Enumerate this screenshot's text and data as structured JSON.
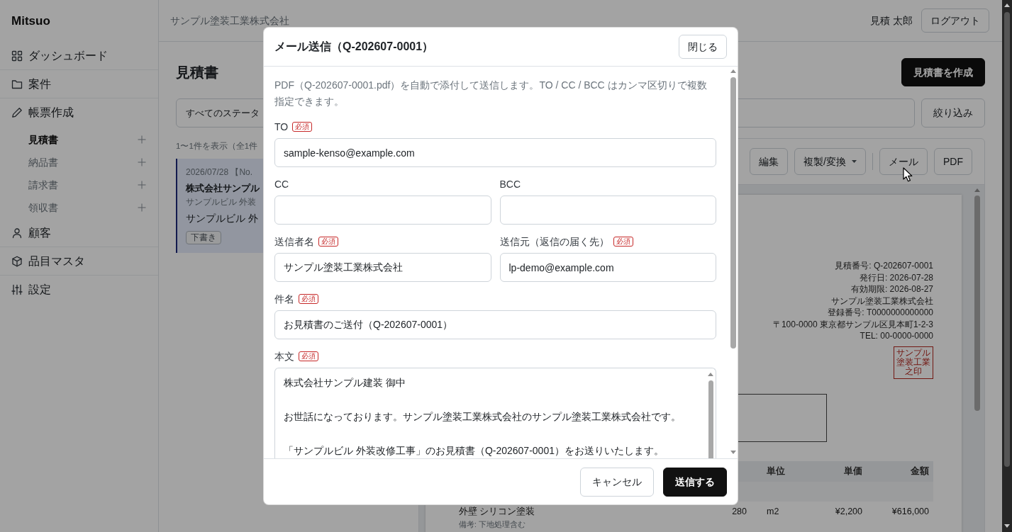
{
  "sidebar": {
    "brand": "Mitsuo",
    "items": [
      {
        "label": "ダッシュボード",
        "selected": false
      },
      {
        "label": "案件",
        "selected": false
      },
      {
        "label": "帳票作成",
        "selected": false,
        "children": [
          {
            "label": "見積書",
            "selected": true
          },
          {
            "label": "納品書",
            "selected": false
          },
          {
            "label": "請求書",
            "selected": false
          },
          {
            "label": "領収書",
            "selected": false
          }
        ]
      },
      {
        "label": "顧客",
        "selected": false
      },
      {
        "label": "品目マスタ",
        "selected": false
      },
      {
        "label": "設定",
        "selected": false
      }
    ]
  },
  "header": {
    "company": "サンプル塗装工業株式会社",
    "user": "見積 太郎",
    "logout_button": "ログアウト"
  },
  "page": {
    "title": "見積書",
    "create_button": "見積書を作成",
    "status_filter": "すべてのステータ",
    "filter_button": "絞り込み",
    "result_count": "1〜1件を表示（全1件"
  },
  "quote_list": [
    {
      "date_number": "2026/07/28 【No.",
      "customer": "株式会社サンプル",
      "subtitle": "サンプルビル 外装",
      "project": "サンプルビル 外",
      "status": "下書き",
      "selected": true
    }
  ],
  "detail": {
    "toolbar_groups": [
      {
        "buttons": [
          {
            "label": "編集",
            "kind": "button"
          },
          {
            "label": "複製/変換",
            "kind": "dropdown"
          }
        ]
      },
      {
        "buttons": [
          {
            "label": "メール",
            "kind": "button"
          },
          {
            "label": "PDF",
            "kind": "button"
          }
        ]
      }
    ],
    "document": {
      "issuer_lines": [
        "見積番号: Q-202607-0001",
        "発行日: 2026-07-28",
        "有効期限: 2026-08-27",
        "サンプル塗装工業株式会社",
        "登録番号: T0000000000000",
        "〒100-0000 東京都サンプル区見本町1-2-3",
        "TEL: 00-0000-0000"
      ],
      "stamp": "サンプル塗装工業之印",
      "columns": [
        "単位",
        "単価",
        "金額"
      ],
      "items": [
        {
          "name": "外壁 シリコン塗装",
          "note": "備考: 下地処理含む",
          "quantity": "280",
          "unit": "m2",
          "unit_price": "¥2,200",
          "amount": "¥616,000"
        }
      ]
    }
  },
  "mail_dialog": {
    "title": "メール送信（Q-202607-0001）",
    "close_button": "閉じる",
    "description": "PDF（Q-202607-0001.pdf）を自動で添付して送信します。TO / CC / BCC はカンマ区切りで複数指定できます。",
    "rows": [
      {
        "fields": [
          {
            "label": "TO",
            "badge": "必須",
            "kind": "input",
            "value": "sample-kenso@example.com"
          }
        ]
      },
      {
        "fields": [
          {
            "label": "CC",
            "kind": "input"
          },
          {
            "label": "BCC",
            "kind": "input"
          }
        ]
      },
      {
        "fields": [
          {
            "label": "送信者名",
            "badge": "必須",
            "kind": "input",
            "value": "サンプル塗装工業株式会社"
          },
          {
            "label": "送信元（返信の届く先）",
            "badge": "必須",
            "kind": "input",
            "value": "lp-demo@example.com"
          }
        ]
      },
      {
        "fields": [
          {
            "label": "件名",
            "badge": "必須",
            "kind": "input",
            "value": "お見積書のご送付（Q-202607-0001）"
          }
        ]
      },
      {
        "fields": [
          {
            "label": "本文",
            "badge": "必須",
            "kind": "textarea",
            "paragraphs": [
              "株式会社サンプル建装 御中",
              "お世話になっております。サンプル塗装工業株式会社のサンプル塗装工業株式会社です。",
              "「サンプルビル 外装改修工事」のお見積書（Q-202607-0001）をお送りいたします。"
            ]
          }
        ]
      }
    ],
    "cancel_button": "キャンセル",
    "send_button": "送信する"
  }
}
